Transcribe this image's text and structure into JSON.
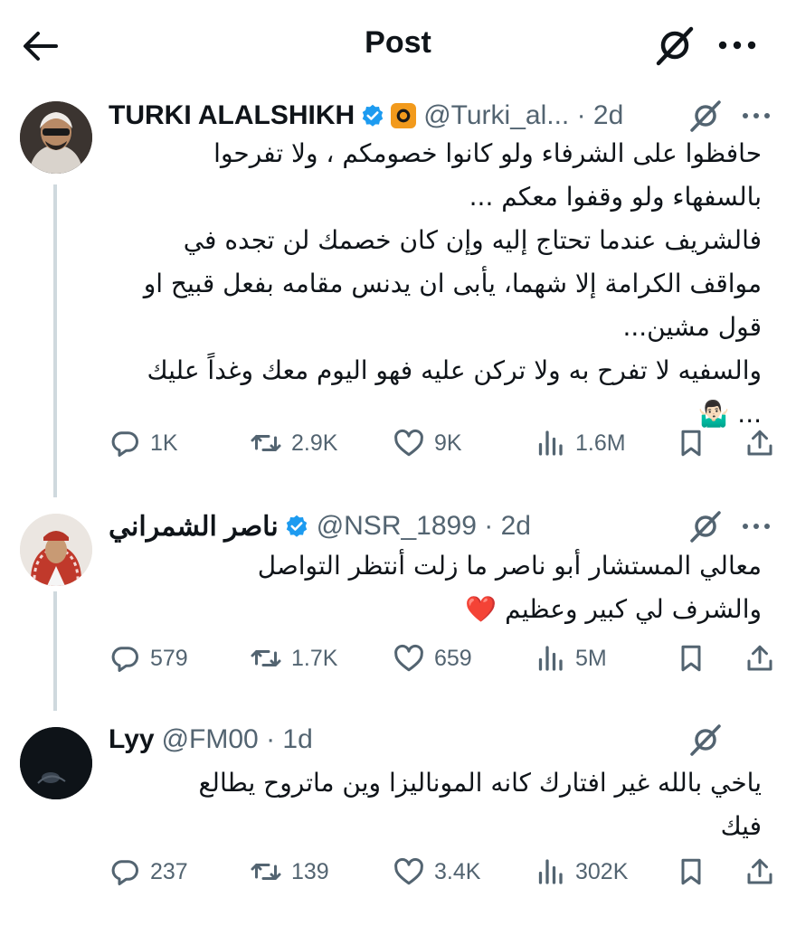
{
  "header": {
    "title": "Post"
  },
  "posts": [
    {
      "name": "TURKI ALALSHIKH",
      "meta": "@Turki_al... · 2d",
      "lines": [
        "حافظوا على الشرفاء ولو كانوا خصومكم ، ولا تفرحوا",
        "بالسفهاء ولو وقفوا معكم ...",
        "فالشريف عندما تحتاج إليه وإن كان خصمك لن تجده في",
        "مواقف الكرامة إلا شهما، يأبى ان يدنس مقامه بفعل قبيح او",
        "قول مشين...",
        "والسفيه لا تفرح به ولا تركن عليه فهو اليوم معك وغداً عليك",
        "... 🤷🏻‍♂️"
      ],
      "stats": {
        "replies": "1K",
        "reposts": "2.9K",
        "likes": "9K",
        "views": "1.6M"
      }
    },
    {
      "name": "ناصر الشمراني",
      "meta": "@NSR_1899 · 2d",
      "lines": [
        "معالي المستشار أبو ناصر ما زلت أنتظر التواصل",
        "والشرف لي كبير وعظيم ❤️"
      ],
      "stats": {
        "replies": "579",
        "reposts": "1.7K",
        "likes": "659",
        "views": "5M"
      }
    },
    {
      "name": "Lyy",
      "meta": "@FM00 · 1d",
      "lines": [
        "ياخي بالله غير افتارك كانه الموناليزا وين ماتروح يطالع",
        "فيك"
      ],
      "stats": {
        "replies": "237",
        "reposts": "139",
        "likes": "3.4K",
        "views": "302K"
      }
    }
  ],
  "colors": {
    "text": "#0f1419",
    "secondary": "#536471",
    "verified": "#1d9bf0",
    "thread_line": "#cfd9de"
  },
  "icons": [
    "back-arrow-icon",
    "grok-icon",
    "more-icon",
    "verified-icon",
    "reply-icon",
    "repost-icon",
    "like-icon",
    "views-icon",
    "bookmark-icon",
    "share-icon"
  ]
}
